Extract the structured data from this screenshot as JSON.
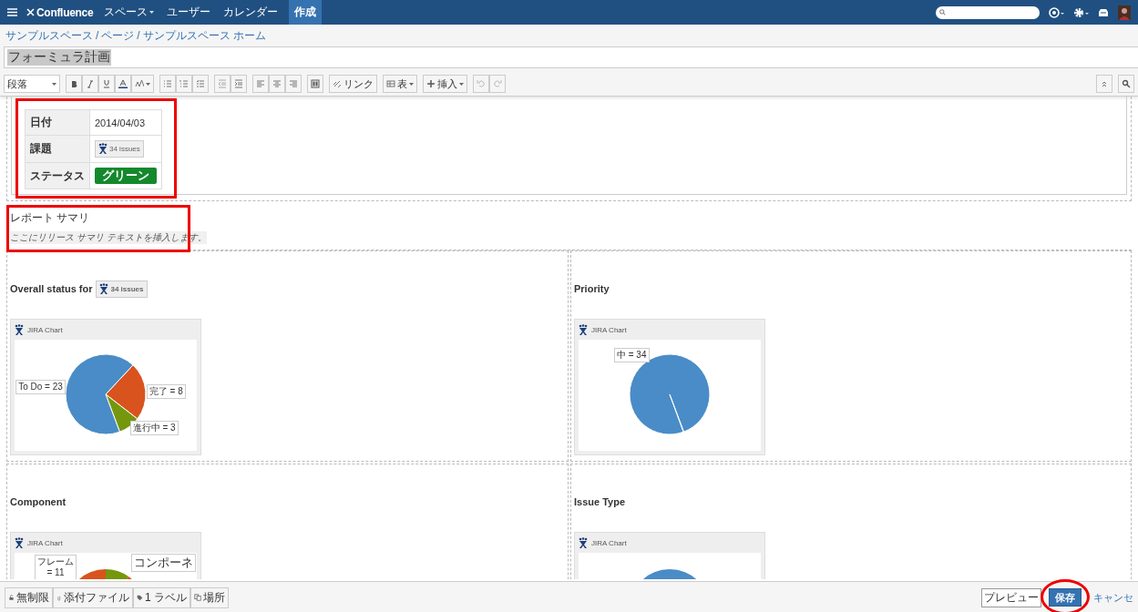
{
  "topbar": {
    "logo": "Confluence",
    "menu": [
      {
        "label": "スペース",
        "dropdown": true,
        "selected": false
      },
      {
        "label": "ユーザー",
        "dropdown": false,
        "selected": false
      },
      {
        "label": "カレンダー",
        "dropdown": false,
        "selected": false
      }
    ],
    "create": "作成"
  },
  "breadcrumb": [
    {
      "label": "サンプルスペース",
      "separator": "/"
    },
    {
      "label": "ページ",
      "separator": "/"
    },
    {
      "label": "サンプルスペース ホーム"
    }
  ],
  "title": "フォーミュラ計画",
  "toolbar": {
    "style": "段落",
    "link": "リンク",
    "table": "表",
    "insert": "挿入"
  },
  "info_table": {
    "rows": [
      {
        "label": "日付",
        "kind": "text",
        "value": "2014/04/03"
      },
      {
        "label": "課題",
        "kind": "issues",
        "value": "34 issues"
      },
      {
        "label": "ステータス",
        "kind": "status",
        "value": "グリーン",
        "color": "#14892c"
      }
    ]
  },
  "summary": {
    "heading": "レポート サマリ",
    "placeholder": "ここにリリース サマリ テキストを挿入します。"
  },
  "panels": [
    {
      "heading": "Overall status for",
      "issues": "34 issues",
      "chart_title": "JIRA Chart",
      "chart_data": {
        "type": "pie",
        "values": [
          23,
          8,
          3
        ],
        "colors": [
          "#4a8cc7",
          "#d9531e",
          "#74970e"
        ],
        "value_labels": [
          "To Do = 23",
          "完了 = 8",
          "進行中 = 3"
        ]
      }
    },
    {
      "heading": "Priority",
      "chart_title": "JIRA Chart",
      "chart_data": {
        "type": "pie",
        "values": [
          34
        ],
        "colors": [
          "#4a8cc7"
        ],
        "value_labels": [
          "中 = 34"
        ]
      }
    },
    {
      "heading": "Component",
      "chart_title": "JIRA Chart",
      "labels": [
        "フレーム",
        "= 11",
        "コンポーネ"
      ]
    },
    {
      "heading": "Issue Type",
      "chart_title": "JIRA Chart"
    }
  ],
  "footer": {
    "restrictions": "無制限",
    "attachments": "添付ファイル",
    "labels": "1 ラベル",
    "location": "場所",
    "preview": "プレビュー",
    "save": "保存",
    "cancel": "キャンセ"
  }
}
